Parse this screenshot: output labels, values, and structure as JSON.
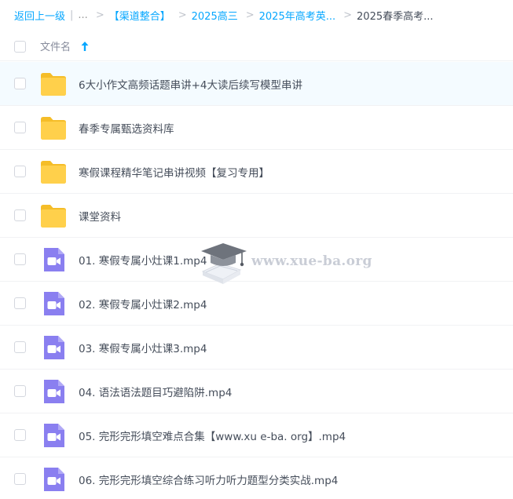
{
  "breadcrumb": {
    "back": "返回上一级",
    "sep": "|",
    "dots": "...",
    "crumbs": [
      "【渠道整合】",
      "2025高三",
      "2025年高考英..."
    ],
    "current": "2025春季高考..."
  },
  "header": {
    "file_name_label": "文件名"
  },
  "files": [
    {
      "type": "folder",
      "name": "6大小作文高频话题串讲+4大读后续写模型串讲"
    },
    {
      "type": "folder",
      "name": "春季专属甄选资料库"
    },
    {
      "type": "folder",
      "name": "寒假课程精华笔记串讲视频【复习专用】"
    },
    {
      "type": "folder",
      "name": "课堂资料"
    },
    {
      "type": "video",
      "name": "01. 寒假专属小灶课1.mp4"
    },
    {
      "type": "video",
      "name": "02. 寒假专属小灶课2.mp4"
    },
    {
      "type": "video",
      "name": "03. 寒假专属小灶课3.mp4"
    },
    {
      "type": "video",
      "name": "04. 语法语法题目巧避陷阱.mp4"
    },
    {
      "type": "video",
      "name": "05. 完形完形填空难点合集【www.xu e-ba. org】.mp4"
    },
    {
      "type": "video",
      "name": "06. 完形完形填空综合练习听力听力题型分类实战.mp4"
    }
  ],
  "watermark": {
    "text": "www.xue-ba.org"
  },
  "colors": {
    "link": "#06a7ff",
    "folder": "#ffd04b",
    "video": "#8a7ff0",
    "highlight": "#f4fbff"
  }
}
